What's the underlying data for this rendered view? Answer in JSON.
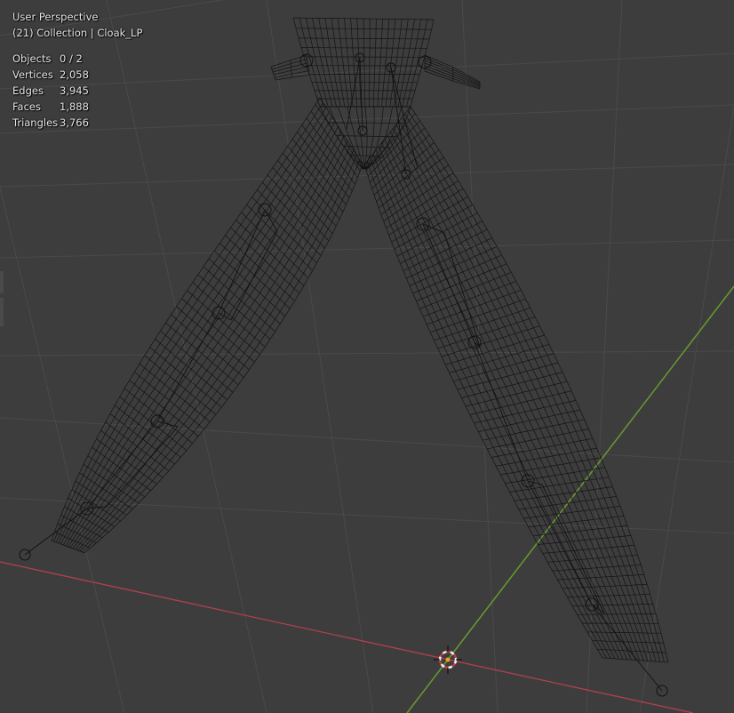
{
  "viewport": {
    "title": "User Perspective",
    "collection": "(21) Collection | Cloak_LP",
    "stats": [
      {
        "label": "Objects",
        "value": "0 / 2"
      },
      {
        "label": "Vertices",
        "value": "2,058"
      },
      {
        "label": "Edges",
        "value": "3,945"
      },
      {
        "label": "Faces",
        "value": "1,888"
      },
      {
        "label": "Triangles",
        "value": "3,766"
      }
    ]
  },
  "colors": {
    "background": "#3d3d3d",
    "grid": "#4a4a4a",
    "x_axis": "#b0404f",
    "y_axis": "#6a9a30",
    "wire": "#121212",
    "cursor_ring_a": "#c8383a",
    "cursor_ring_b": "#f0f0f0",
    "origin_dot": "#f0a020"
  }
}
